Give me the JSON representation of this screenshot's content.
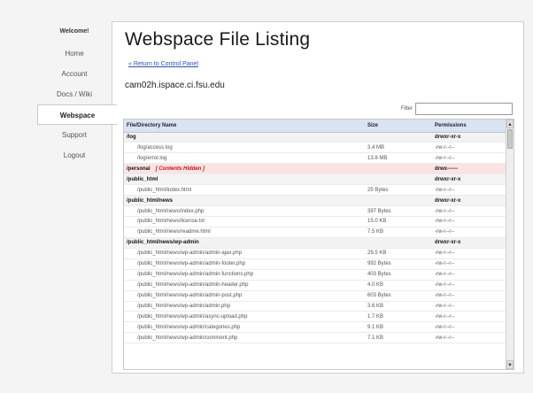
{
  "nav": {
    "welcome": "Welcome!",
    "items": [
      {
        "label": "Home"
      },
      {
        "label": "Account"
      },
      {
        "label": "Docs / Wiki"
      },
      {
        "label": "Webspace",
        "active": true
      },
      {
        "label": "Support"
      },
      {
        "label": "Logout"
      }
    ]
  },
  "page": {
    "title": "Webspace File Listing",
    "back_link": "« Return to Control Panel",
    "host": "cam02h.ispace.ci.fsu.edu"
  },
  "filter": {
    "label": "Filter",
    "value": ""
  },
  "table": {
    "headers": {
      "name": "File/Directory Name",
      "size": "Size",
      "permissions": "Permissions"
    },
    "rows": [
      {
        "type": "dir",
        "name": "/log",
        "size": "",
        "perm": "drwxr-xr-x"
      },
      {
        "type": "file",
        "name": "/log/access.log",
        "size": "3.4 MB",
        "perm": "-rw-r--r--"
      },
      {
        "type": "file",
        "name": "/log/error.log",
        "size": "13.8 MB",
        "perm": "-rw-r--r--"
      },
      {
        "type": "dir",
        "name": "/personal",
        "note": "[ Contents Hidden ]",
        "hidden": true,
        "size": "",
        "perm": "drwx------"
      },
      {
        "type": "dir",
        "name": "/public_html",
        "size": "",
        "perm": "drwxr-xr-x"
      },
      {
        "type": "file",
        "name": "/public_html/index.html",
        "size": "25 Bytes",
        "perm": "-rw-r--r--"
      },
      {
        "type": "dir",
        "name": "/public_html/news",
        "size": "",
        "perm": "drwxr-xr-x"
      },
      {
        "type": "file",
        "name": "/public_html/news/index.php",
        "size": "397 Bytes",
        "perm": "-rw-r--r--"
      },
      {
        "type": "file",
        "name": "/public_html/news/license.txt",
        "size": "15.0 KB",
        "perm": "-rw-r--r--"
      },
      {
        "type": "file",
        "name": "/public_html/news/readme.html",
        "size": "7.5 KB",
        "perm": "-rw-r--r--"
      },
      {
        "type": "dir",
        "name": "/public_html/news/wp-admin",
        "size": "",
        "perm": "drwxr-xr-x"
      },
      {
        "type": "file",
        "name": "/public_html/news/wp-admin/admin-ajax.php",
        "size": "29.5 KB",
        "perm": "-rw-r--r--"
      },
      {
        "type": "file",
        "name": "/public_html/news/wp-admin/admin-footer.php",
        "size": "992 Bytes",
        "perm": "-rw-r--r--"
      },
      {
        "type": "file",
        "name": "/public_html/news/wp-admin/admin-functions.php",
        "size": "403 Bytes",
        "perm": "-rw-r--r--"
      },
      {
        "type": "file",
        "name": "/public_html/news/wp-admin/admin-header.php",
        "size": "4.0 KB",
        "perm": "-rw-r--r--"
      },
      {
        "type": "file",
        "name": "/public_html/news/wp-admin/admin-post.php",
        "size": "603 Bytes",
        "perm": "-rw-r--r--"
      },
      {
        "type": "file",
        "name": "/public_html/news/wp-admin/admin.php",
        "size": "3.6 KB",
        "perm": "-rw-r--r--"
      },
      {
        "type": "file",
        "name": "/public_html/news/wp-admin/async-upload.php",
        "size": "1.7 KB",
        "perm": "-rw-r--r--"
      },
      {
        "type": "file",
        "name": "/public_html/news/wp-admin/categories.php",
        "size": "9.1 KB",
        "perm": "-rw-r--r--"
      },
      {
        "type": "file",
        "name": "/public_html/news/wp-admin/comment.php",
        "size": "7.1 KB",
        "perm": "-rw-r--r--"
      }
    ]
  },
  "scrollbar": {
    "up_icon": "arrow-up-icon",
    "down_icon": "arrow-down-icon"
  },
  "colors": {
    "header_bg": "#d9e3f2",
    "hidden_row_bg": "#fbe3e3",
    "hidden_note": "#c0101a",
    "link": "#3050b0"
  }
}
